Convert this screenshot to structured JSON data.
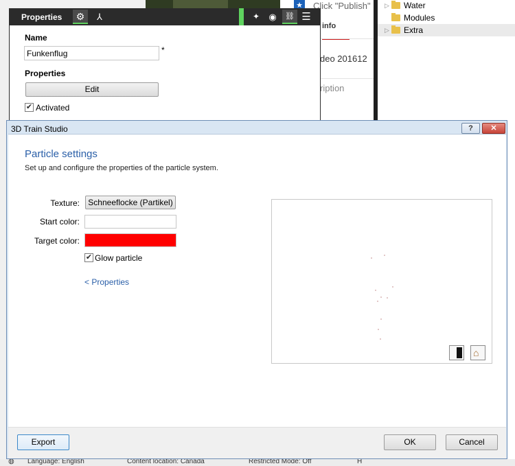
{
  "background": {
    "yt": {
      "publish_hint": "Click \"Publish\" t",
      "tab_info": "info",
      "video_title": "deo 201612",
      "description": "ription"
    },
    "tree": {
      "items": [
        {
          "label": "Water",
          "selected": false
        },
        {
          "label": "Modules",
          "selected": false
        },
        {
          "label": "Extra",
          "selected": true
        }
      ]
    },
    "footer_strip": {
      "language": "Language: English",
      "content_location": "Content location: Canada",
      "restricted_mode": "Restricted Mode: Off",
      "help": "H"
    }
  },
  "properties_panel": {
    "title": "Properties",
    "name_label": "Name",
    "name_value": "Funkenflug",
    "required_mark": "*",
    "properties_label": "Properties",
    "edit_button": "Edit",
    "activated_label": "Activated",
    "activated_checked": true,
    "icons": [
      "gear-icon",
      "node-icon",
      "pin-icon",
      "eye-icon",
      "link-icon",
      "menu-icon"
    ]
  },
  "dialog": {
    "window_title": "3D Train Studio",
    "help_button": "?",
    "close_button": "✕",
    "heading": "Particle settings",
    "subheading": "Set up and configure the properties of the particle system.",
    "texture_label": "Texture:",
    "texture_button": "Schneeflocke (Partikel)",
    "start_color_label": "Start color:",
    "start_color": "#ffffff",
    "target_color_label": "Target color:",
    "target_color": "#ff0000",
    "glow_label": "Glow particle",
    "glow_checked": true,
    "back_link": "< Properties",
    "export_button": "Export",
    "ok_button": "OK",
    "cancel_button": "Cancel"
  },
  "colors": {
    "accent_green": "#5fd35f",
    "dialog_blue": "#2a5fa8",
    "close_red": "#c7453a"
  }
}
